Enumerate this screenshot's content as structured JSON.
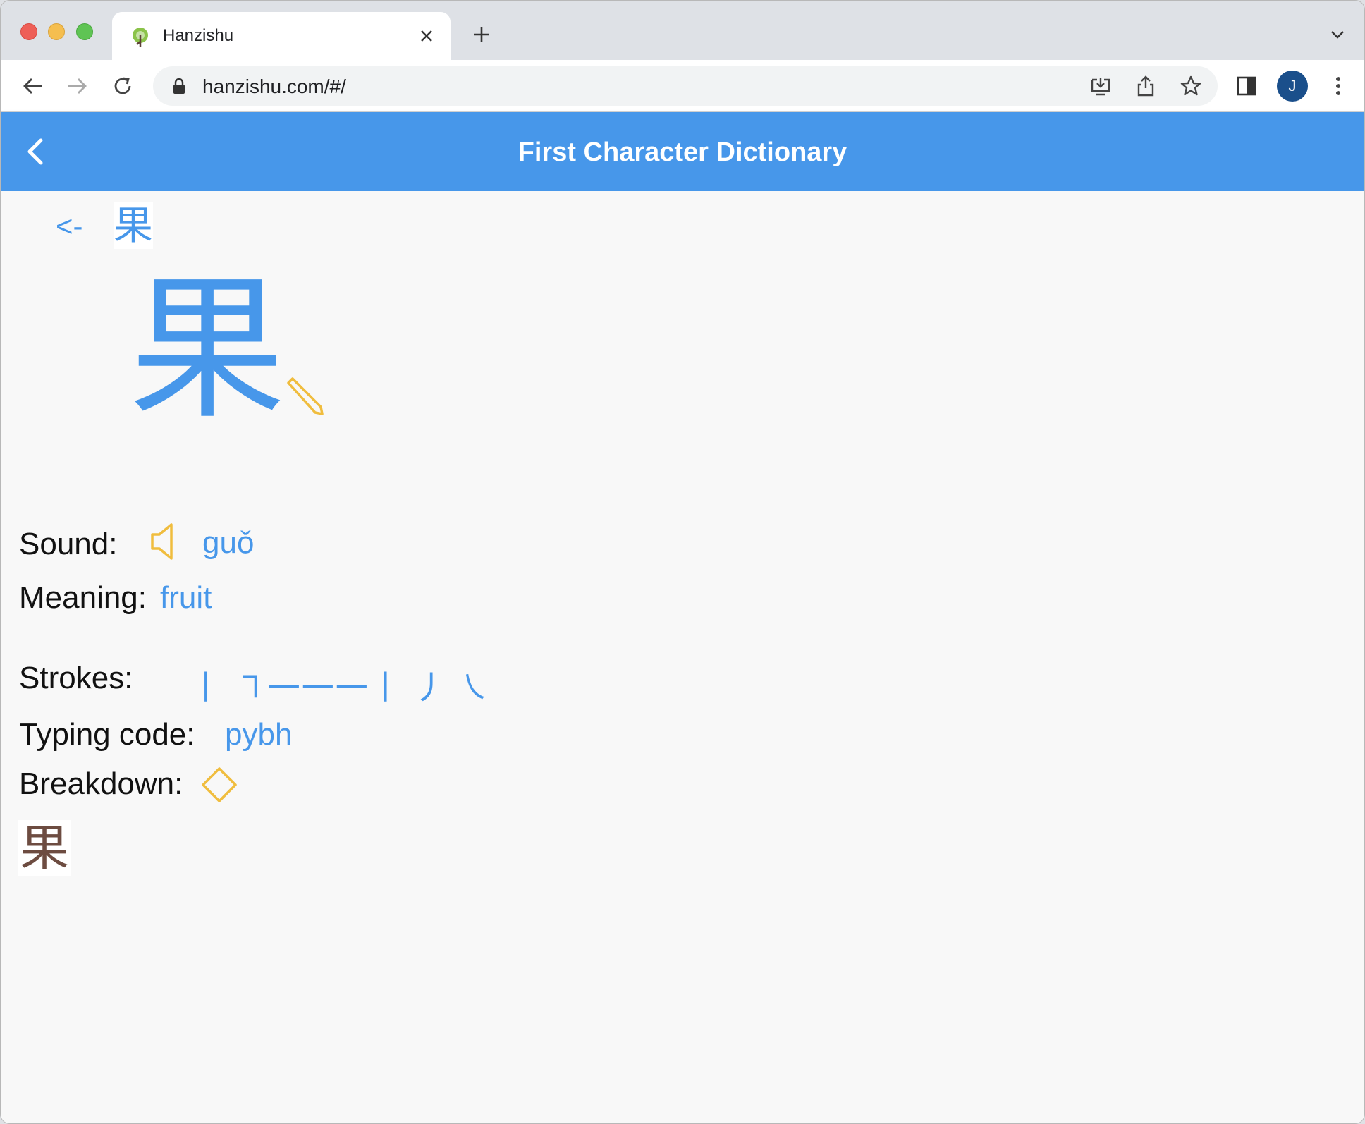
{
  "browser": {
    "tab_title": "Hanzishu",
    "url": "hanzishu.com/#/",
    "avatar_initial": "J"
  },
  "app": {
    "title": "First Character Dictionary"
  },
  "breadcrumb": {
    "back_arrow": "<-",
    "character": "果"
  },
  "character": {
    "glyph": "果",
    "sound_label": "Sound:",
    "pinyin": "guǒ",
    "meaning_label": "Meaning:",
    "meaning": "fruit",
    "strokes_label": "Strokes:",
    "strokes": "丨 ㇕一一一丨 丿 ㇏",
    "typing_label": "Typing code:",
    "typing_code": "pybh",
    "breakdown_label": "Breakdown:",
    "breakdown_parts": [
      "果"
    ]
  },
  "colors": {
    "primary": "#4797ea",
    "accent": "#f0bd3e",
    "component": "#6d4c41"
  }
}
